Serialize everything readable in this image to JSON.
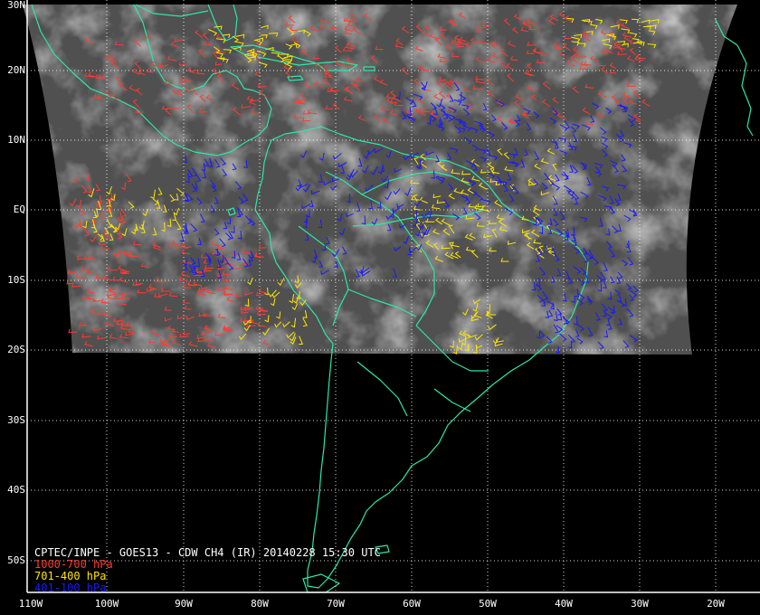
{
  "map": {
    "caption": "CPTEC/INPE - GOES13 - CDW CH4 (IR) 20140228 15:30 UTC",
    "legend": [
      {
        "label": "1000-700 hPa",
        "color": "#ff3b30"
      },
      {
        "label": "701-400 hPa",
        "color": "#ffe600"
      },
      {
        "label": "401-100 hPa",
        "color": "#1a1aff"
      }
    ],
    "lat_labels": [
      "30N",
      "20N",
      "10N",
      "EQ",
      "10S",
      "20S",
      "30S",
      "40S",
      "50S"
    ],
    "lon_labels": [
      "110W",
      "100W",
      "90W",
      "80W",
      "70W",
      "60W",
      "50W",
      "40W",
      "30W",
      "20W"
    ],
    "colors": {
      "coastline": "#2ee6a8",
      "grid": "#ffffff",
      "background": "#000000",
      "ir_cloud": "#555555"
    }
  }
}
